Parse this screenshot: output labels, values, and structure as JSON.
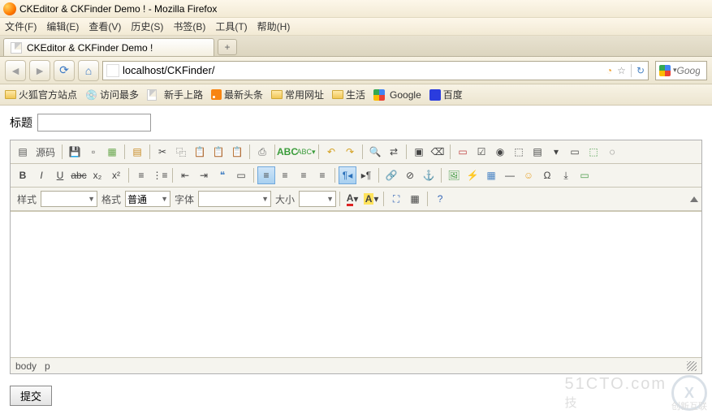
{
  "window": {
    "title": "CKEditor & CKFinder Demo ! - Mozilla Firefox"
  },
  "menu": {
    "file": "文件(F)",
    "edit": "编辑(E)",
    "view": "查看(V)",
    "history": "历史(S)",
    "bookmarks": "书签(B)",
    "tools": "工具(T)",
    "help": "帮助(H)"
  },
  "tab": {
    "title": "CKEditor & CKFinder Demo !",
    "new": "+"
  },
  "nav": {
    "url": "localhost/CKFinder/",
    "search_placeholder": "Google"
  },
  "bookmarks": {
    "b1": "火狐官方站点",
    "b2": "访问最多",
    "b3": "新手上路",
    "b4": "最新头条",
    "b5": "常用网址",
    "b6": "生活",
    "b7": "Google",
    "b8": "百度"
  },
  "page": {
    "title_label": "标题",
    "submit": "提交"
  },
  "editor": {
    "source": "源码",
    "styles_lbl": "样式",
    "styles_val": "",
    "format_lbl": "格式",
    "format_val": "普通",
    "font_lbl": "字体",
    "font_val": "",
    "size_lbl": "大小",
    "size_val": "",
    "status1": "body",
    "status2": "p"
  },
  "watermark": {
    "big": "51CTO.com",
    "small": "技",
    "logo": "X",
    "brand": "创新互联"
  }
}
